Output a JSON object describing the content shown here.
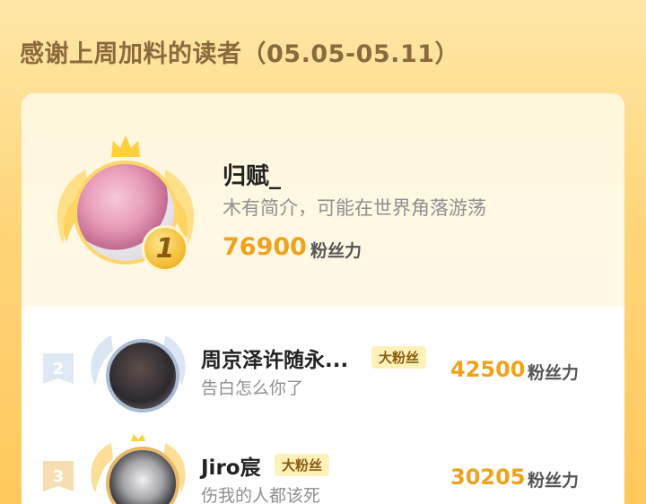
{
  "header": {
    "title": "感谢上周加料的读者（05.05-05.11）"
  },
  "colors": {
    "accent": "#f0a21c",
    "background": "#ffd57a",
    "title": "#8a6a3d"
  },
  "top_reader": {
    "rank": "1",
    "name": "归赋_",
    "bio": "木有简介，可能在世界角落游荡",
    "score": "76900",
    "unit": "粉丝力"
  },
  "readers": [
    {
      "rank": "2",
      "name": "周京泽许随永...",
      "tag": "大粉丝",
      "bio": "告白怎么你了",
      "score": "42500",
      "unit": "粉丝力"
    },
    {
      "rank": "3",
      "name": "Jiro宸",
      "tag": "大粉丝",
      "bio": "伤我的人都该死",
      "score": "30205",
      "unit": "粉丝力"
    }
  ]
}
